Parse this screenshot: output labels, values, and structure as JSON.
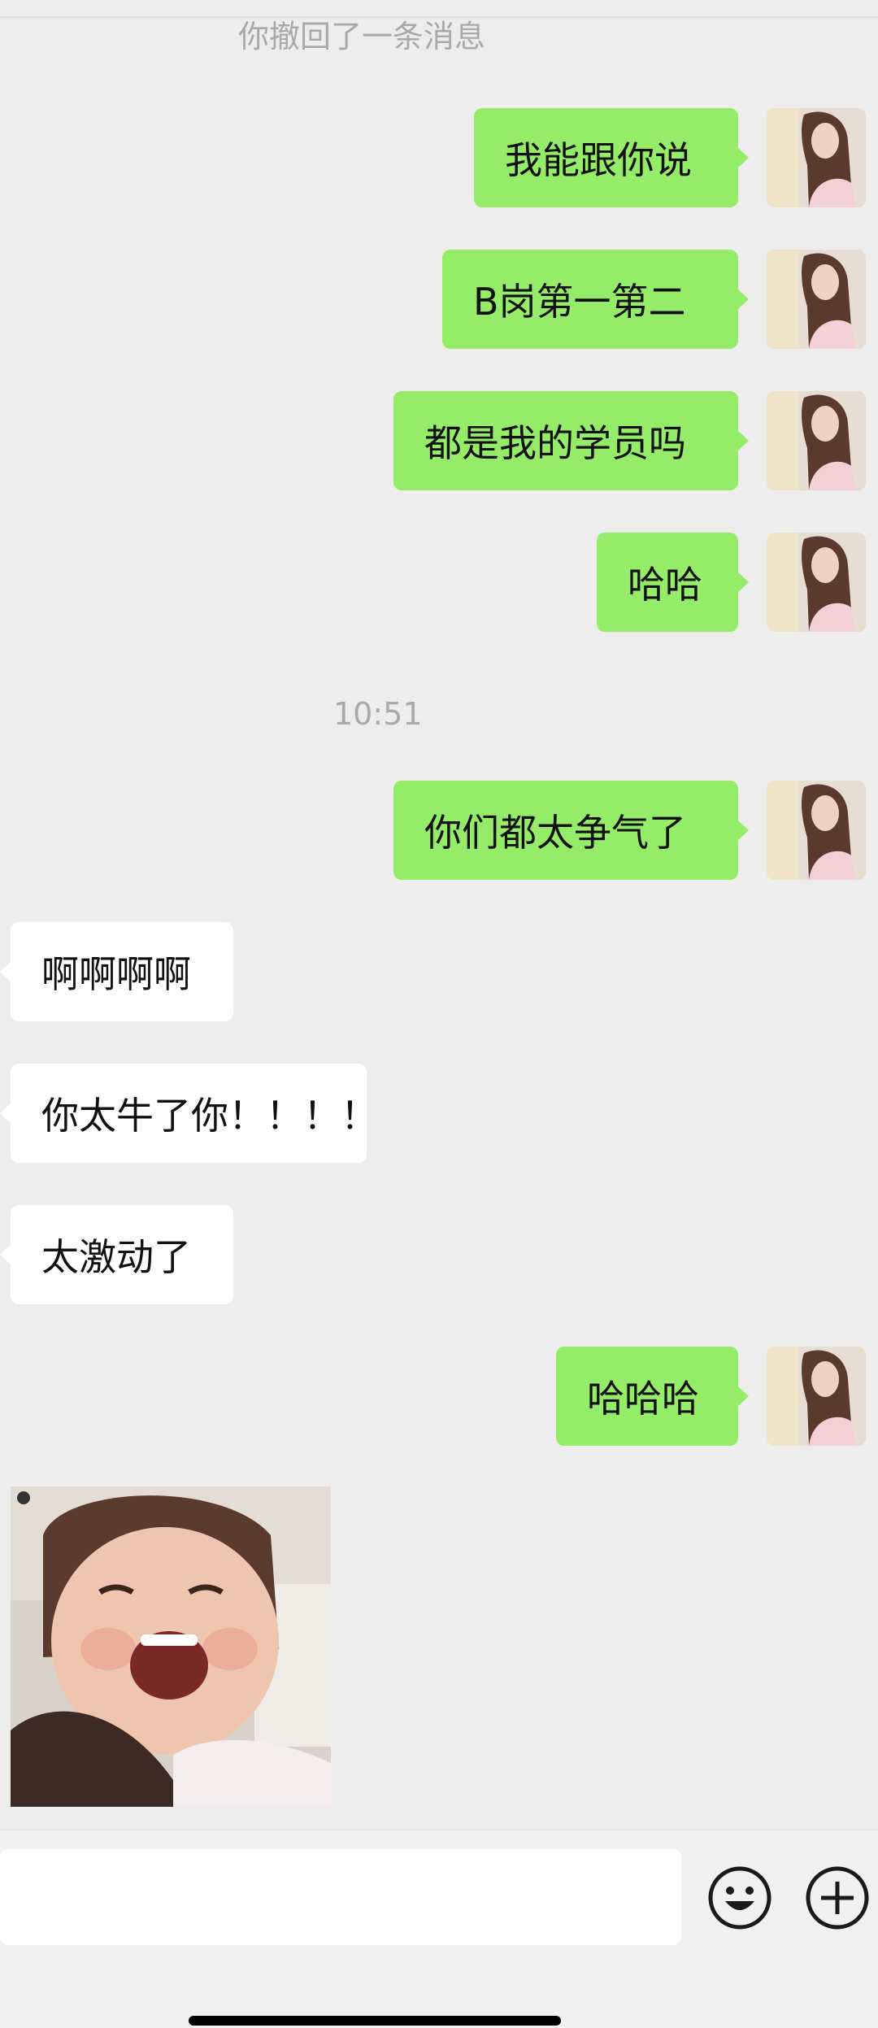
{
  "system": {
    "recall_notice": "你撤回了一条消息",
    "timestamp": "10:51"
  },
  "messages": [
    {
      "from": "me",
      "text": "我能跟你说"
    },
    {
      "from": "me",
      "text": "B岗第一第二"
    },
    {
      "from": "me",
      "text": "都是我的学员吗"
    },
    {
      "from": "me",
      "text": "哈哈"
    },
    {
      "from": "me",
      "text": "你们都太争气了"
    },
    {
      "from": "other",
      "text": "啊啊啊啊"
    },
    {
      "from": "other",
      "text": "你太牛了你！！！！"
    },
    {
      "from": "other",
      "text": "太激动了"
    },
    {
      "from": "me",
      "text": "哈哈哈"
    },
    {
      "from": "other",
      "type": "sticker",
      "icon": "laughing-baby-sticker"
    }
  ],
  "input": {
    "value": "",
    "emoji_icon": "smiley-face-icon",
    "more_icon": "plus-circle-icon"
  },
  "colors": {
    "background": "#ededed",
    "my_bubble": "#95ec69",
    "their_bubble": "#ffffff",
    "system_text": "#a9a9a9"
  }
}
